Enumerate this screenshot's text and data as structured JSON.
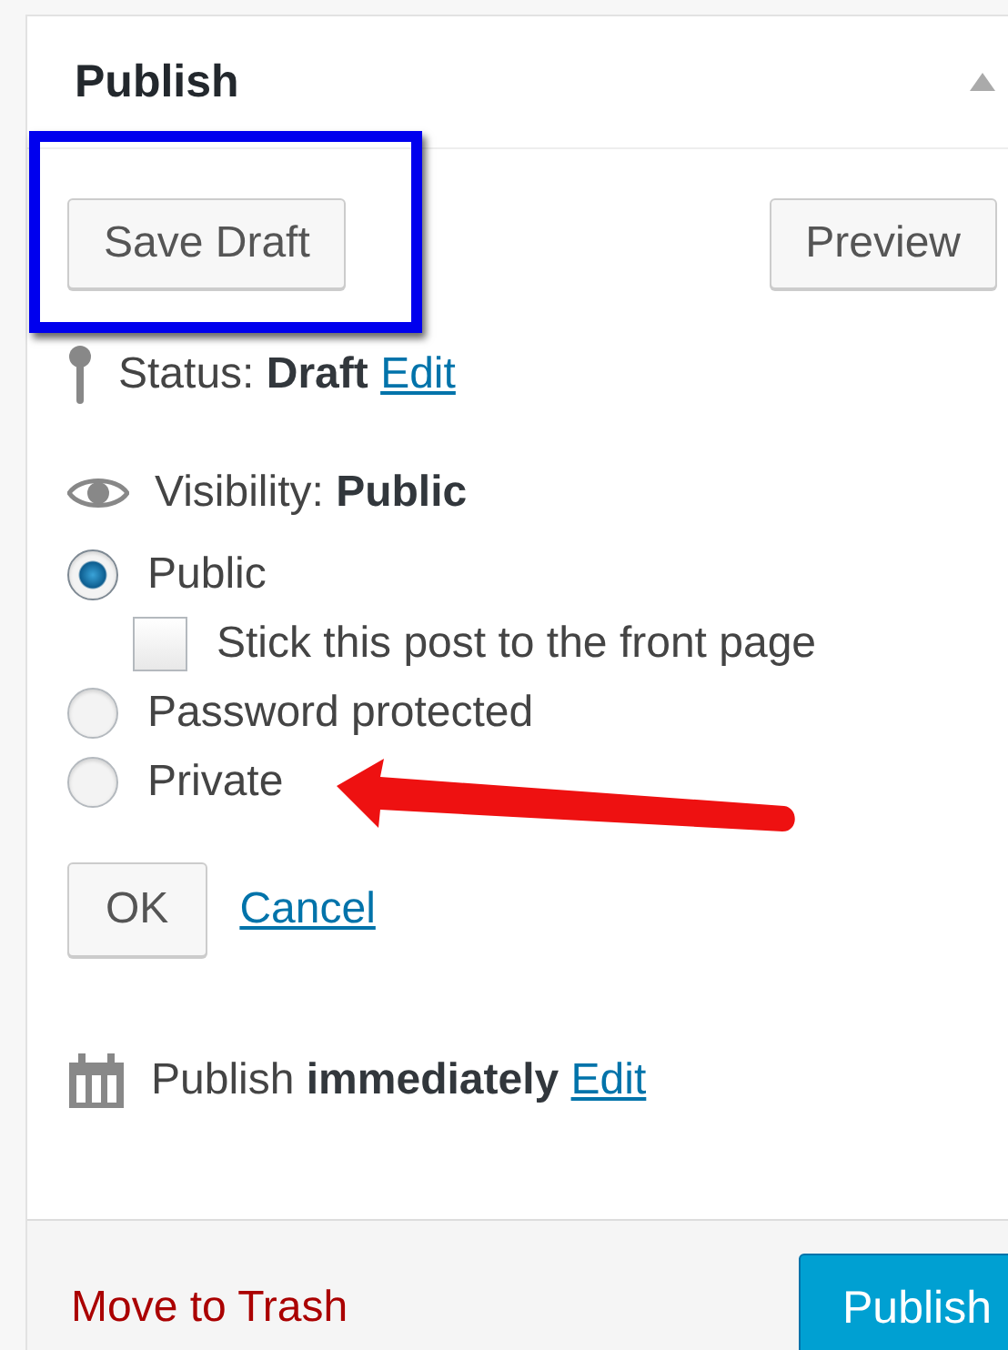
{
  "panel": {
    "title": "Publish"
  },
  "top_buttons": [
    {
      "label": "Save Draft"
    },
    {
      "label": "Preview"
    }
  ],
  "status": {
    "text": "Status: **Draft**",
    "link": "Edit"
  },
  "visibility": {
    "text": "Visibility: **Public**"
  },
  "options": [
    {
      "kind": "radio",
      "label": "Public",
      "selected": true
    },
    {
      "kind": "checkbox",
      "label": "Stick this post to the front page",
      "checked": false
    },
    {
      "kind": "radio",
      "label": "Password protected",
      "selected": false
    },
    {
      "kind": "radio",
      "label": "Private",
      "selected": false
    }
  ],
  "actions": {
    "ok": "OK",
    "cancel": "Cancel"
  },
  "schedule": {
    "text": "Publish **immediately**",
    "link": "Edit"
  },
  "footer": {
    "trash": "Move to Trash",
    "publish": "Publish"
  }
}
